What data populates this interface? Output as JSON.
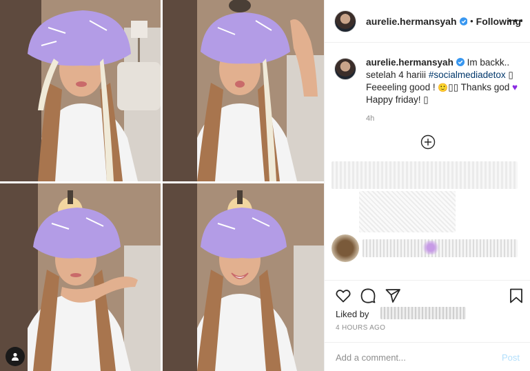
{
  "post": {
    "username": "aurelie.hermansyah",
    "follow_status": "Following",
    "separator": "•",
    "caption": {
      "username": "aurelie.hermansyah",
      "line1": "Im backk..",
      "line2_prefix": "setelah 4 hariii ",
      "hashtag": "#socialmediadetox",
      "line3_prefix": "Feeeeling good ! ",
      "line3_suffix": " Thanks god ",
      "line4": "Happy friday! ",
      "placeholder_glyph": "▯",
      "relative_time": "4h"
    },
    "liked_by_label": "Liked by",
    "timestamp": "4 HOURS AGO",
    "comment_placeholder": "Add a comment...",
    "post_label": "Post"
  },
  "colors": {
    "text": "#262626",
    "muted": "#8e8e8e",
    "hashtag": "#00376b",
    "verified": "#3897f0",
    "post_disabled": "#b2dffc",
    "heart": "#8a2be2"
  },
  "icons": {
    "verified": "verified-badge-icon",
    "more": "more-options-icon",
    "load_more": "plus-circle-icon",
    "like": "heart-icon",
    "comment": "comment-bubble-icon",
    "share": "paper-plane-icon",
    "save": "bookmark-icon",
    "user_tag": "user-tag-icon"
  }
}
